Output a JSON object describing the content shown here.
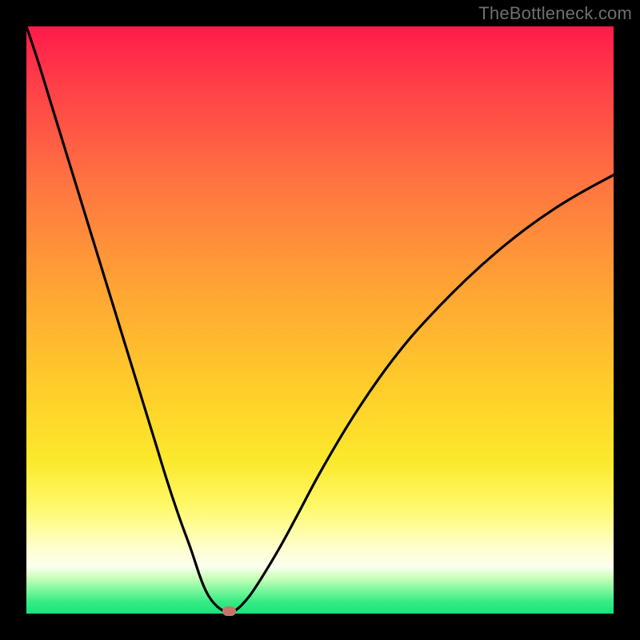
{
  "attribution": "TheBottleneck.com",
  "colors": {
    "frame": "#000000",
    "curve_stroke": "#000000",
    "marker": "#c77469",
    "gradient_top": "#ff1a4b",
    "gradient_bottom_green": "#17e47b"
  },
  "chart_data": {
    "type": "line",
    "title": "",
    "xlabel": "",
    "ylabel": "",
    "xlim": [
      0,
      100
    ],
    "ylim": [
      0,
      100
    ],
    "background": "red-yellow-green vertical gradient (red=top=high bottleneck, green=bottom=low bottleneck)",
    "series": [
      {
        "name": "bottleneck-curve-left",
        "x": [
          0,
          2,
          4,
          6,
          8,
          10,
          12,
          14,
          16,
          18,
          20,
          22,
          24,
          26,
          28,
          29.5,
          30.5,
          31.5,
          32.5,
          33.5,
          34.5
        ],
        "values": [
          100,
          94,
          87.5,
          81,
          74.5,
          68,
          61.5,
          55,
          48.5,
          42,
          35.5,
          29,
          22.5,
          16.5,
          11,
          6.5,
          4,
          2.3,
          1.2,
          0.5,
          0.05
        ]
      },
      {
        "name": "bottleneck-curve-right",
        "x": [
          34.5,
          35.5,
          36.5,
          38,
          40,
          43,
          46,
          50,
          55,
          60,
          65,
          70,
          75,
          80,
          85,
          90,
          95,
          100
        ],
        "values": [
          0.05,
          0.5,
          1.3,
          3.0,
          6.0,
          11.0,
          16.5,
          24.0,
          32.5,
          40.0,
          46.5,
          52.0,
          57.0,
          61.5,
          65.5,
          69.0,
          72.0,
          74.7
        ]
      }
    ],
    "marker": {
      "x": 34.5,
      "y": 0.0,
      "meaning": "target/optimal point (minimum bottleneck)"
    },
    "grid": false,
    "legend": false
  }
}
